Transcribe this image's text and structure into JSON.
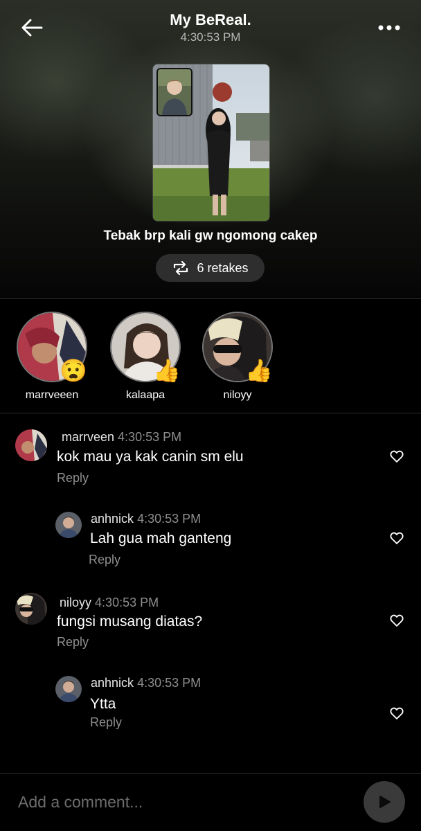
{
  "header": {
    "title": "My BeReal.",
    "time": "4:30:53 PM"
  },
  "post": {
    "caption": "Tebak brp kali gw ngomong cakep",
    "retakes_label": "6 retakes"
  },
  "reactions": [
    {
      "name": "marrveeen",
      "emoji": "😧"
    },
    {
      "name": "kalaapa",
      "emoji": "👍"
    },
    {
      "name": "niloyy",
      "emoji": "👍"
    }
  ],
  "comments": [
    {
      "user": "marrveen",
      "time": "4:30:53 PM",
      "text": "kok mau ya kak canin sm elu",
      "reply": "Reply"
    },
    {
      "user": "anhnick",
      "time": "4:30:53 PM",
      "text": "Lah gua mah ganteng",
      "reply": "Reply"
    },
    {
      "user": "niloyy",
      "time": "4:30:53 PM",
      "text": "fungsi musang diatas?",
      "reply": "Reply"
    },
    {
      "user": "anhnick",
      "time": "4:30:53 PM",
      "text": "Ytta",
      "reply": "Reply"
    }
  ],
  "composer": {
    "placeholder": "Add a comment..."
  },
  "icons": {
    "back": "arrow-left-icon",
    "more": "more-dots-icon",
    "retake": "repeat-icon",
    "heart": "heart-outline-icon",
    "send": "send-play-icon"
  }
}
